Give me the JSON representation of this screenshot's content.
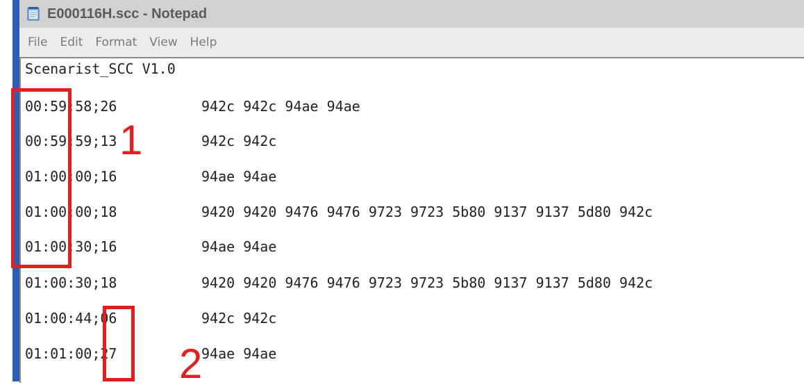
{
  "window": {
    "title": "E000116H.scc - Notepad",
    "icon": "notepad-icon"
  },
  "menu": [
    "File",
    "Edit",
    "Format",
    "View",
    "Help"
  ],
  "document": {
    "header": "Scenarist_SCC V1.0",
    "lines": [
      {
        "timestamp": "00:59:58;26",
        "data": "942c 942c 94ae 94ae"
      },
      {
        "timestamp": "00:59:59;13",
        "data": "942c 942c"
      },
      {
        "timestamp": "01:00:00;16",
        "data": "94ae 94ae"
      },
      {
        "timestamp": "01:00:00;18",
        "data": "9420 9420 9476 9476 9723 9723 5b80 9137 9137 5d80 942c"
      },
      {
        "timestamp": "01:00:30;16",
        "data": "94ae 94ae"
      },
      {
        "timestamp": "01:00:30;18",
        "data": "9420 9420 9476 9476 9723 9723 5b80 9137 9137 5d80 942c"
      },
      {
        "timestamp": "01:00:44;06",
        "data": "942c 942c"
      },
      {
        "timestamp": "01:01:00;27",
        "data": "94ae 94ae"
      }
    ]
  },
  "annotations": [
    {
      "label": "1",
      "color": "#e02020"
    },
    {
      "label": "2",
      "color": "#e02020"
    }
  ]
}
